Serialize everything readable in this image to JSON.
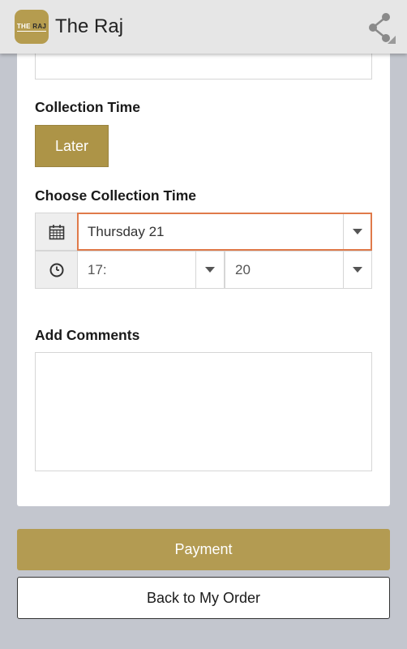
{
  "app": {
    "title": "The Raj",
    "logo_text_the": "THE",
    "logo_text_raj": "RAJ",
    "brand_color": "#b39b52"
  },
  "toolbar": {
    "share_icon": "share-icon"
  },
  "collection": {
    "label": "Collection Time",
    "later_label": "Later"
  },
  "choose_time": {
    "label": "Choose Collection Time",
    "date_value": "Thursday 21",
    "hour_value": "17:",
    "minute_value": "20",
    "date_icon": "calendar-icon",
    "time_icon": "clock-icon",
    "active_border_color": "#e07a4a"
  },
  "comments": {
    "label": "Add Comments",
    "value": ""
  },
  "actions": {
    "payment_label": "Payment",
    "back_label": "Back to My Order"
  }
}
